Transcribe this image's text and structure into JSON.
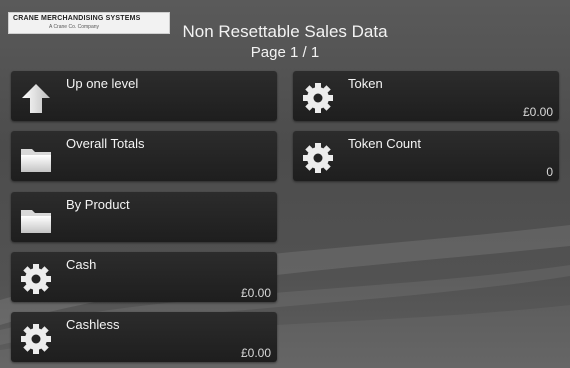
{
  "header": {
    "logo_text": "CRANE MERCHANDISING SYSTEMS",
    "logo_subtext": "A Crane Co. Company",
    "title": "Non Resettable Sales Data",
    "page_indicator": "Page 1 / 1"
  },
  "menu": {
    "left": [
      {
        "label": "Up one level",
        "icon": "up-arrow-icon",
        "value": ""
      },
      {
        "label": "Overall Totals",
        "icon": "folder-icon",
        "value": ""
      },
      {
        "label": "By Product",
        "icon": "folder-icon",
        "value": ""
      },
      {
        "label": "Cash",
        "icon": "gear-icon",
        "value": "£0.00"
      },
      {
        "label": "Cashless",
        "icon": "gear-icon",
        "value": "£0.00"
      }
    ],
    "right": [
      {
        "label": "Token",
        "icon": "gear-icon",
        "value": "£0.00"
      },
      {
        "label": "Token Count",
        "icon": "gear-icon",
        "value": "0"
      }
    ]
  }
}
